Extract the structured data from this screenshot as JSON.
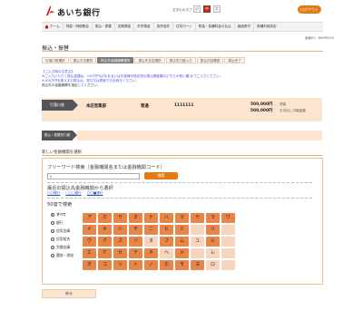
{
  "header": {
    "brand": "あいち銀行",
    "font_size_label": "文字の大きさ",
    "font_sizes": [
      "小",
      "中",
      "大"
    ],
    "logout_label": "ログアウト"
  },
  "nav": [
    "ホーム",
    "残高・明細照会",
    "振込・振替",
    "定期預金",
    "外貨預金",
    "投資信託",
    "住宅ローン",
    "税金・各種料金の払込",
    "諸届受付",
    "各種利用設定"
  ],
  "screen_id": "画面ID：BKMR005",
  "page_title": "振込・振替",
  "steps": [
    "引落口座選択",
    "振込方法選択",
    "振込先金融機関選択",
    "振込先支店選択",
    "振込先口座入力",
    "振込内容確認",
    "振込完了"
  ],
  "notes": {
    "heading": "【ご入力時の注意点】",
    "lines": [
      "※ご入力いただく振込金額は、100万円以内(あるいはお客様が設定済の振込限度額のどちらか低い額)までご入力ください。",
      "※100万円を超えるお振込は、窓口又は書面でお手続きください。"
    ],
    "tail": "振込先の金融機関を指定してください。"
  },
  "source": {
    "tag": "引落口座",
    "branch": "本店営業部",
    "type": "普通",
    "number": "1111111",
    "amount1": "500,000円",
    "amount1_label": "残高",
    "amount2": "500,000円",
    "amount2_label": "お引出し可能金額"
  },
  "dest_tag": "振込・振替先口座",
  "select": {
    "heading": "新しい金融機関を選択",
    "free_search_title": "フリーワード検索（金融機関名または金融機関コード）",
    "search_value": "ｼ",
    "search_button": "検索",
    "recent_title": "最近の振込先金融機関から選択",
    "recent_links": [
      "〇〇銀行",
      "□□□銀行",
      "〇〇■銀行"
    ],
    "kana_title": "50音で検索",
    "categories": [
      "すべて",
      "銀行",
      "信用金庫",
      "信用組合",
      "労働金庫",
      "農協・漁協"
    ],
    "selected_category": "すべて",
    "kana": [
      "ア",
      "カ",
      "サ",
      "タ",
      "ナ",
      "ハ",
      "マ",
      "ヤ",
      "ラ",
      "ワ",
      "イ",
      "キ",
      "シ",
      "チ",
      "ニ",
      "ヒ",
      "ミ",
      "",
      "リ",
      "",
      "ウ",
      "ク",
      "ス",
      "ツ",
      "ヌ",
      "フ",
      "ム",
      "ユ",
      "ル",
      "",
      "エ",
      "ケ",
      "セ",
      "テ",
      "ネ",
      "ヘ",
      "メ",
      "",
      "レ",
      "",
      "オ",
      "コ",
      "ソ",
      "ト",
      "ノ",
      "ホ",
      "モ",
      "ヨ",
      "ロ",
      ""
    ]
  },
  "back_label": "戻る",
  "colors": {
    "accent": "#e47b15",
    "panel": "#fce4cf",
    "brand_red": "#c4161c"
  }
}
